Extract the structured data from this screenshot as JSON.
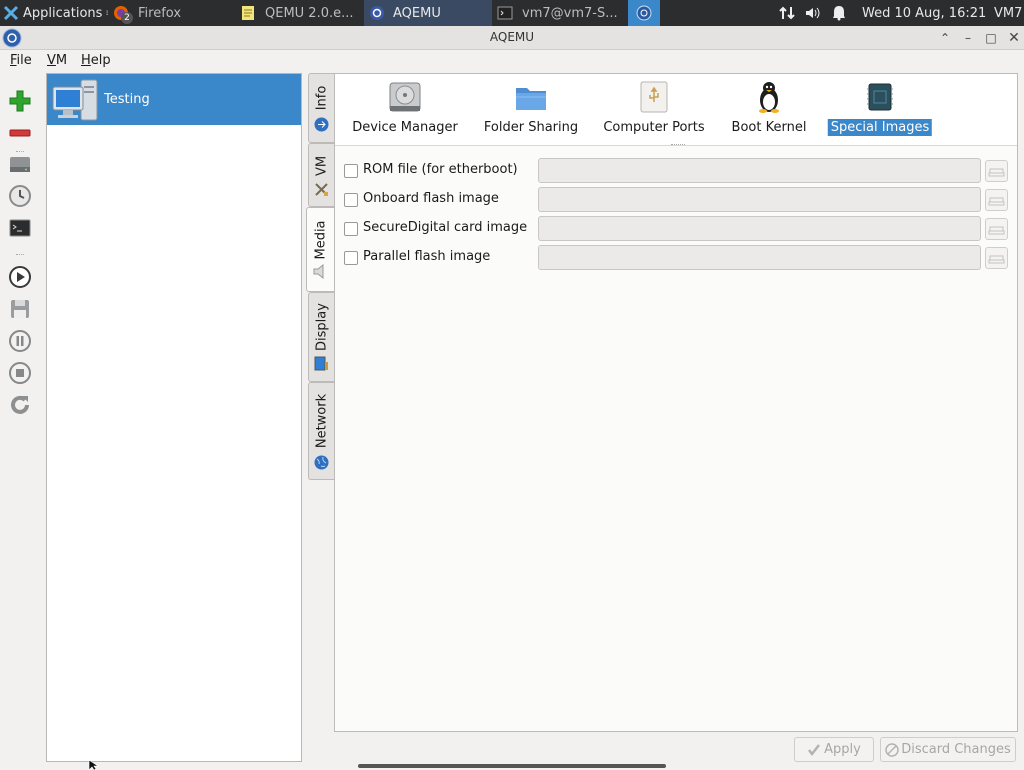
{
  "taskbar": {
    "applications_label": "Applications",
    "items": [
      {
        "label": "Firefox",
        "badge": "2"
      },
      {
        "label": "QEMU 2.0.e..."
      },
      {
        "label": "AQEMU"
      },
      {
        "label": "vm7@vm7-S..."
      }
    ],
    "clock": "Wed 10 Aug, 16:21",
    "user": "VM7"
  },
  "window": {
    "title": "AQEMU"
  },
  "menu": {
    "file": {
      "first": "F",
      "rest": "ile"
    },
    "vm": {
      "first": "V",
      "rest": "M"
    },
    "help": {
      "first": "H",
      "rest": "elp"
    }
  },
  "vm_list": [
    {
      "name": "Testing",
      "icon": "computer-icon"
    }
  ],
  "tabs": [
    {
      "label": "Info",
      "icon": "info-icon"
    },
    {
      "label": "VM",
      "icon": "tools-icon"
    },
    {
      "label": "Media",
      "icon": "speaker-icon"
    },
    {
      "label": "Display",
      "icon": "monitor-icon"
    },
    {
      "label": "Network",
      "icon": "globe-icon"
    }
  ],
  "devices": [
    {
      "label": "Device Manager",
      "icon": "harddisk-icon"
    },
    {
      "label": "Folder Sharing",
      "icon": "folder-icon"
    },
    {
      "label": "Computer Ports",
      "icon": "usb-icon"
    },
    {
      "label": "Boot Kernel",
      "icon": "tux-icon"
    },
    {
      "label": "Special Images",
      "icon": "chip-icon"
    }
  ],
  "images": [
    {
      "label": "ROM file (for etherboot)",
      "value": "",
      "checked": false
    },
    {
      "label": "Onboard flash image",
      "value": "",
      "checked": false
    },
    {
      "label": "SecureDigital card image",
      "value": "",
      "checked": false
    },
    {
      "label": "Parallel flash image",
      "value": "",
      "checked": false
    }
  ],
  "buttons": {
    "apply": "Apply",
    "discard": "Discard Changes"
  },
  "colors": {
    "selection": "#3a87c9",
    "taskbar": "#2b2d2e"
  }
}
